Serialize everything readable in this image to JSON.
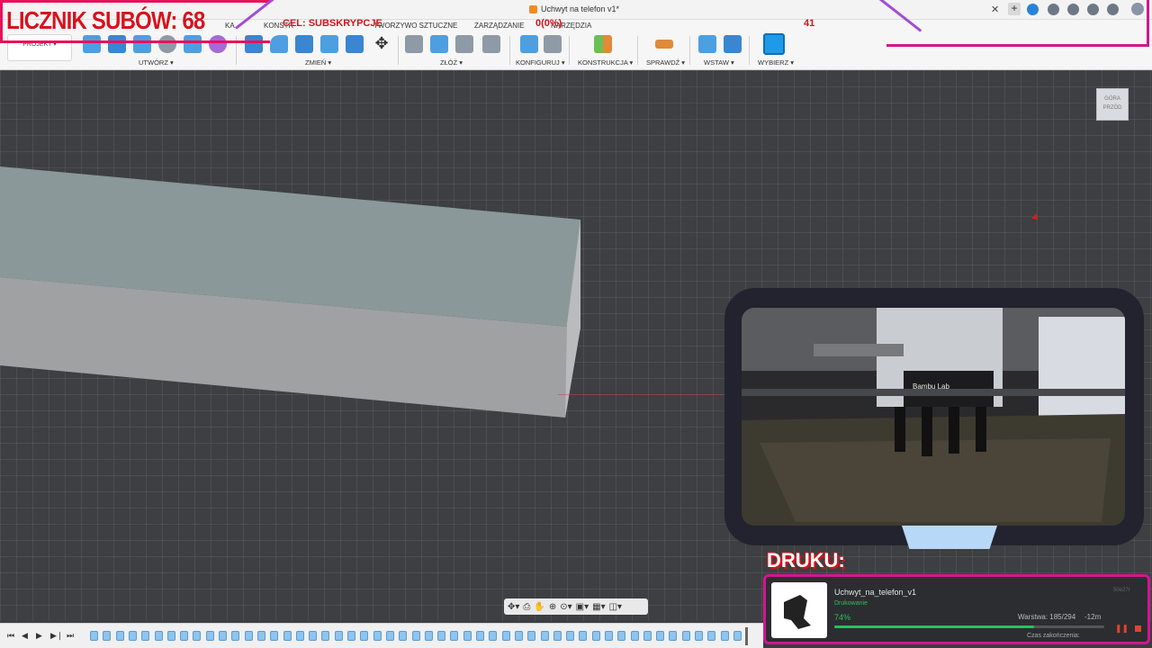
{
  "window": {
    "doc_title": "Uchwyt na telefon v1*"
  },
  "toolbar": {
    "tabs": [
      "KONSTR",
      "TWORZYWO SZTUCZNE",
      "ZARZĄDZANIE",
      "NARZĘDZIA"
    ],
    "tab_partial_left": "KA",
    "project_label": "PROJEKT ▾",
    "groups": [
      {
        "label": "UTWÓRZ ▾"
      },
      {
        "label": "ZMIEŃ ▾"
      },
      {
        "label": "ZŁÓŻ ▾"
      },
      {
        "label": "KONFIGURUJ ▾"
      },
      {
        "label": "KONSTRUKCJA ▾"
      },
      {
        "label": "SPRAWDŹ ▾"
      },
      {
        "label": "WSTAW ▾"
      },
      {
        "label": "WYBIERZ ▾"
      }
    ]
  },
  "viewcube": {
    "top": "GÓRA",
    "front": "PRZÓD"
  },
  "overlay": {
    "counter": "LICZNIK SUBÓW: 68",
    "goal": "CEL: SUBSKRYPCJE",
    "goal_value": "0(0%)",
    "goal_target": "41",
    "camera_label": "DRUKU:",
    "camera_brand": "Bambu Lab"
  },
  "print": {
    "name": "Uchwyt_na_telefon_v1",
    "status": "Drukowanie",
    "percent": "74%",
    "progress": 0.74,
    "layer": "Warstwa: 185/294",
    "remaining": "-12m",
    "finish_label": "Czas zakończenia:",
    "card_id": "50e27r"
  },
  "colors": {
    "accent_red": "#d8121c",
    "frame_pink": "#d41590",
    "progress_green": "#26c15c"
  }
}
